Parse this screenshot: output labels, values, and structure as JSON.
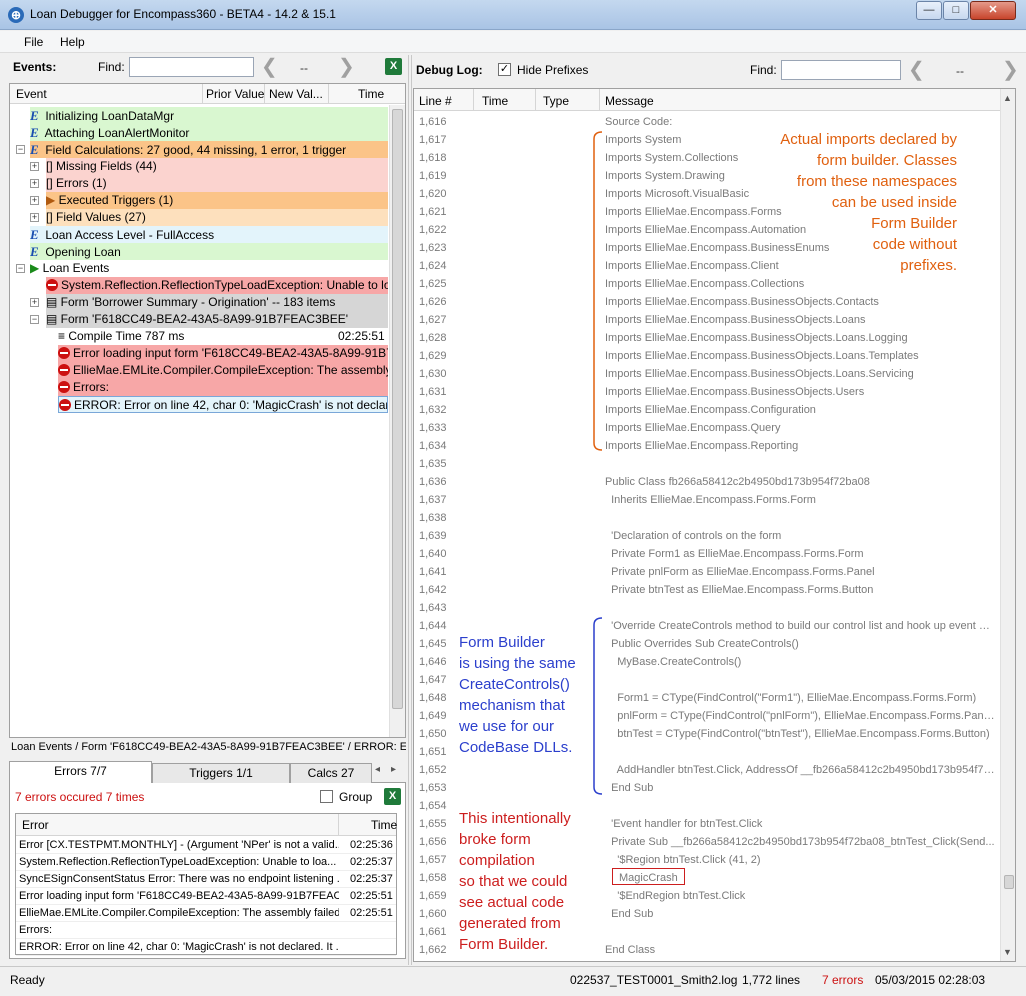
{
  "window": {
    "title": "Loan Debugger for Encompass360 - BETA4 - 14.2 & 15.1",
    "icon": "crosshair-globe-icon",
    "min": "—",
    "max": "□",
    "close": "✕"
  },
  "menu": [
    "File",
    "Help"
  ],
  "events": {
    "label": "Events:",
    "find_label": "Find:",
    "nav_prev": "❮",
    "nav_count": "--",
    "nav_next": "❯",
    "columns": [
      "Event",
      "Prior Value",
      "New Val...",
      "Time"
    ],
    "rows": [
      {
        "text": "Initializing LoanDataMgr"
      },
      {
        "text": "Attaching LoanAlertMonitor"
      },
      {
        "text": "Field Calculations: 27 good, 44 missing, 1 error, 1 trigger"
      },
      {
        "text": "Missing Fields (44)"
      },
      {
        "text": "Errors (1)"
      },
      {
        "text": "Executed Triggers (1)"
      },
      {
        "text": "Field Values (27)"
      },
      {
        "text": "Loan Access Level - FullAccess"
      },
      {
        "text": "Opening Loan"
      },
      {
        "text": "Loan Events"
      },
      {
        "text": "System.Reflection.ReflectionTypeLoadException:  Unable  to loa"
      },
      {
        "text": "Form 'Borrower Summary - Origination' -- 183 items"
      },
      {
        "text": "Form 'F618CC49-BEA2-43A5-8A99-91B7FEAC3BEE'"
      },
      {
        "text": "Compile Time 787 ms",
        "time": "02:25:51"
      },
      {
        "text": "Error loading input form 'F618CC49-BEA2-43A5-8A99-91B7F"
      },
      {
        "text": "EllieMae.EMLite.Compiler.CompileException:  The assembly f"
      },
      {
        "text": "Errors:"
      },
      {
        "text": "ERROR: Error on line 42, char 0: 'MagicCrash' is not declared"
      }
    ]
  },
  "breadcrumb": "Loan Events / Form 'F618CC49-BEA2-43A5-8A99-91B7FEAC3BEE' / ERROR: Erro",
  "tabs": [
    "Errors 7/7",
    "Triggers 1/1",
    "Calcs 27"
  ],
  "errors_panel": {
    "summary": "7 errors occured 7 times",
    "group_label": "Group",
    "columns": [
      "Error",
      "Time"
    ],
    "rows": [
      {
        "msg": "Error [CX.TESTPMT.MONTHLY] - (Argument 'NPer' is not a valid...",
        "time": "02:25:36"
      },
      {
        "msg": "System.Reflection.ReflectionTypeLoadException: Unable to loa...",
        "time": "02:25:37"
      },
      {
        "msg": "SyncESignConsentStatus Error: There was no endpoint listening ...",
        "time": "02:25:37"
      },
      {
        "msg": "Error loading input form 'F618CC49-BEA2-43A5-8A99-91B7FEAC...",
        "time": "02:25:51"
      },
      {
        "msg": "EllieMae.EMLite.Compiler.CompileException: The assembly failed...",
        "time": "02:25:51"
      },
      {
        "msg": "Errors:",
        "time": ""
      },
      {
        "msg": "ERROR: Error on line 42, char 0: 'MagicCrash' is not declared. It ...",
        "time": ""
      }
    ]
  },
  "debug_log": {
    "label": "Debug Log:",
    "hide_prefixes": "Hide Prefixes",
    "find_label": "Find:",
    "nav_prev": "❮",
    "nav_count": "--",
    "nav_next": "❯",
    "columns": [
      "Line #",
      "Time",
      "Type",
      "Message"
    ],
    "rows": [
      {
        "ln": "1,616",
        "msg": "Source Code:"
      },
      {
        "ln": "1,617",
        "msg": "Imports System"
      },
      {
        "ln": "1,618",
        "msg": "Imports System.Collections"
      },
      {
        "ln": "1,619",
        "msg": "Imports System.Drawing"
      },
      {
        "ln": "1,620",
        "msg": "Imports Microsoft.VisualBasic"
      },
      {
        "ln": "1,621",
        "msg": "Imports EllieMae.Encompass.Forms"
      },
      {
        "ln": "1,622",
        "msg": "Imports EllieMae.Encompass.Automation"
      },
      {
        "ln": "1,623",
        "msg": "Imports EllieMae.Encompass.BusinessEnums"
      },
      {
        "ln": "1,624",
        "msg": "Imports EllieMae.Encompass.Client"
      },
      {
        "ln": "1,625",
        "msg": "Imports EllieMae.Encompass.Collections"
      },
      {
        "ln": "1,626",
        "msg": "Imports EllieMae.Encompass.BusinessObjects.Contacts"
      },
      {
        "ln": "1,627",
        "msg": "Imports EllieMae.Encompass.BusinessObjects.Loans"
      },
      {
        "ln": "1,628",
        "msg": "Imports EllieMae.Encompass.BusinessObjects.Loans.Logging"
      },
      {
        "ln": "1,629",
        "msg": "Imports EllieMae.Encompass.BusinessObjects.Loans.Templates"
      },
      {
        "ln": "1,630",
        "msg": "Imports EllieMae.Encompass.BusinessObjects.Loans.Servicing"
      },
      {
        "ln": "1,631",
        "msg": "Imports EllieMae.Encompass.BusinessObjects.Users"
      },
      {
        "ln": "1,632",
        "msg": "Imports EllieMae.Encompass.Configuration"
      },
      {
        "ln": "1,633",
        "msg": "Imports EllieMae.Encompass.Query"
      },
      {
        "ln": "1,634",
        "msg": "Imports EllieMae.Encompass.Reporting"
      },
      {
        "ln": "1,635",
        "msg": ""
      },
      {
        "ln": "1,636",
        "msg": "Public Class fb266a58412c2b4950bd173b954f72ba08"
      },
      {
        "ln": "1,637",
        "msg": "  Inherits EllieMae.Encompass.Forms.Form"
      },
      {
        "ln": "1,638",
        "msg": ""
      },
      {
        "ln": "1,639",
        "msg": "  'Declaration of controls on the form"
      },
      {
        "ln": "1,640",
        "msg": "  Private Form1 as EllieMae.Encompass.Forms.Form"
      },
      {
        "ln": "1,641",
        "msg": "  Private pnlForm as EllieMae.Encompass.Forms.Panel"
      },
      {
        "ln": "1,642",
        "msg": "  Private btnTest as EllieMae.Encompass.Forms.Button"
      },
      {
        "ln": "1,643",
        "msg": ""
      },
      {
        "ln": "1,644",
        "msg": "  'Override CreateControls method to build our control list and hook up event han..."
      },
      {
        "ln": "1,645",
        "msg": "  Public Overrides Sub CreateControls()"
      },
      {
        "ln": "1,646",
        "msg": "    MyBase.CreateControls()"
      },
      {
        "ln": "1,647",
        "msg": ""
      },
      {
        "ln": "1,648",
        "msg": "    Form1 = CType(FindControl(\"Form1\"), EllieMae.Encompass.Forms.Form)"
      },
      {
        "ln": "1,649",
        "msg": "    pnlForm = CType(FindControl(\"pnlForm\"), EllieMae.Encompass.Forms.Panel)"
      },
      {
        "ln": "1,650",
        "msg": "    btnTest = CType(FindControl(\"btnTest\"), EllieMae.Encompass.Forms.Button)"
      },
      {
        "ln": "1,651",
        "msg": ""
      },
      {
        "ln": "1,652",
        "msg": "    AddHandler btnTest.Click, AddressOf __fb266a58412c2b4950bd173b954f72..."
      },
      {
        "ln": "1,653",
        "msg": "  End Sub"
      },
      {
        "ln": "1,654",
        "msg": ""
      },
      {
        "ln": "1,655",
        "msg": "  'Event handler for btnTest.Click"
      },
      {
        "ln": "1,656",
        "msg": "  Private Sub __fb266a58412c2b4950bd173b954f72ba08_btnTest_Click(Send..."
      },
      {
        "ln": "1,657",
        "msg": "    '$Region btnTest.Click (41, 2)"
      },
      {
        "ln": "1,658",
        "msg": "MagicCrash"
      },
      {
        "ln": "1,659",
        "msg": "    '$EndRegion btnTest.Click"
      },
      {
        "ln": "1,660",
        "msg": "  End Sub"
      },
      {
        "ln": "1,661",
        "msg": ""
      },
      {
        "ln": "1,662",
        "msg": "End Class"
      }
    ]
  },
  "annotations": {
    "orange": [
      "Actual imports declared by",
      "form builder.  Classes",
      "from these namespaces",
      "can be used inside",
      "Form Builder",
      "code without",
      "prefixes."
    ],
    "blue": [
      "Form Builder",
      "is using the same",
      "CreateControls()",
      "mechanism that",
      "we use for our",
      "CodeBase DLLs."
    ],
    "red": [
      "This intentionally",
      "broke form",
      "compilation",
      "so that we could",
      "see actual code",
      "generated from",
      "Form Builder."
    ]
  },
  "status": {
    "ready": "Ready",
    "file": "022537_TEST0001_Smith2.log",
    "lines": "1,772 lines",
    "errors": "7 errors",
    "datetime": "05/03/2015 02:28:03"
  },
  "colors": {
    "green": "#d9f7d0",
    "orange": "#fbc488",
    "red": "#f7a7a7",
    "pink": "#fbd3cf",
    "peach": "#fde0bd",
    "yellow": "#fff3c6",
    "lightblue": "#e3f4fb",
    "gray": "#d6d6d6",
    "annot_orange": "#e0600f",
    "annot_blue": "#2b3fcc",
    "annot_red": "#cc1e1e"
  }
}
